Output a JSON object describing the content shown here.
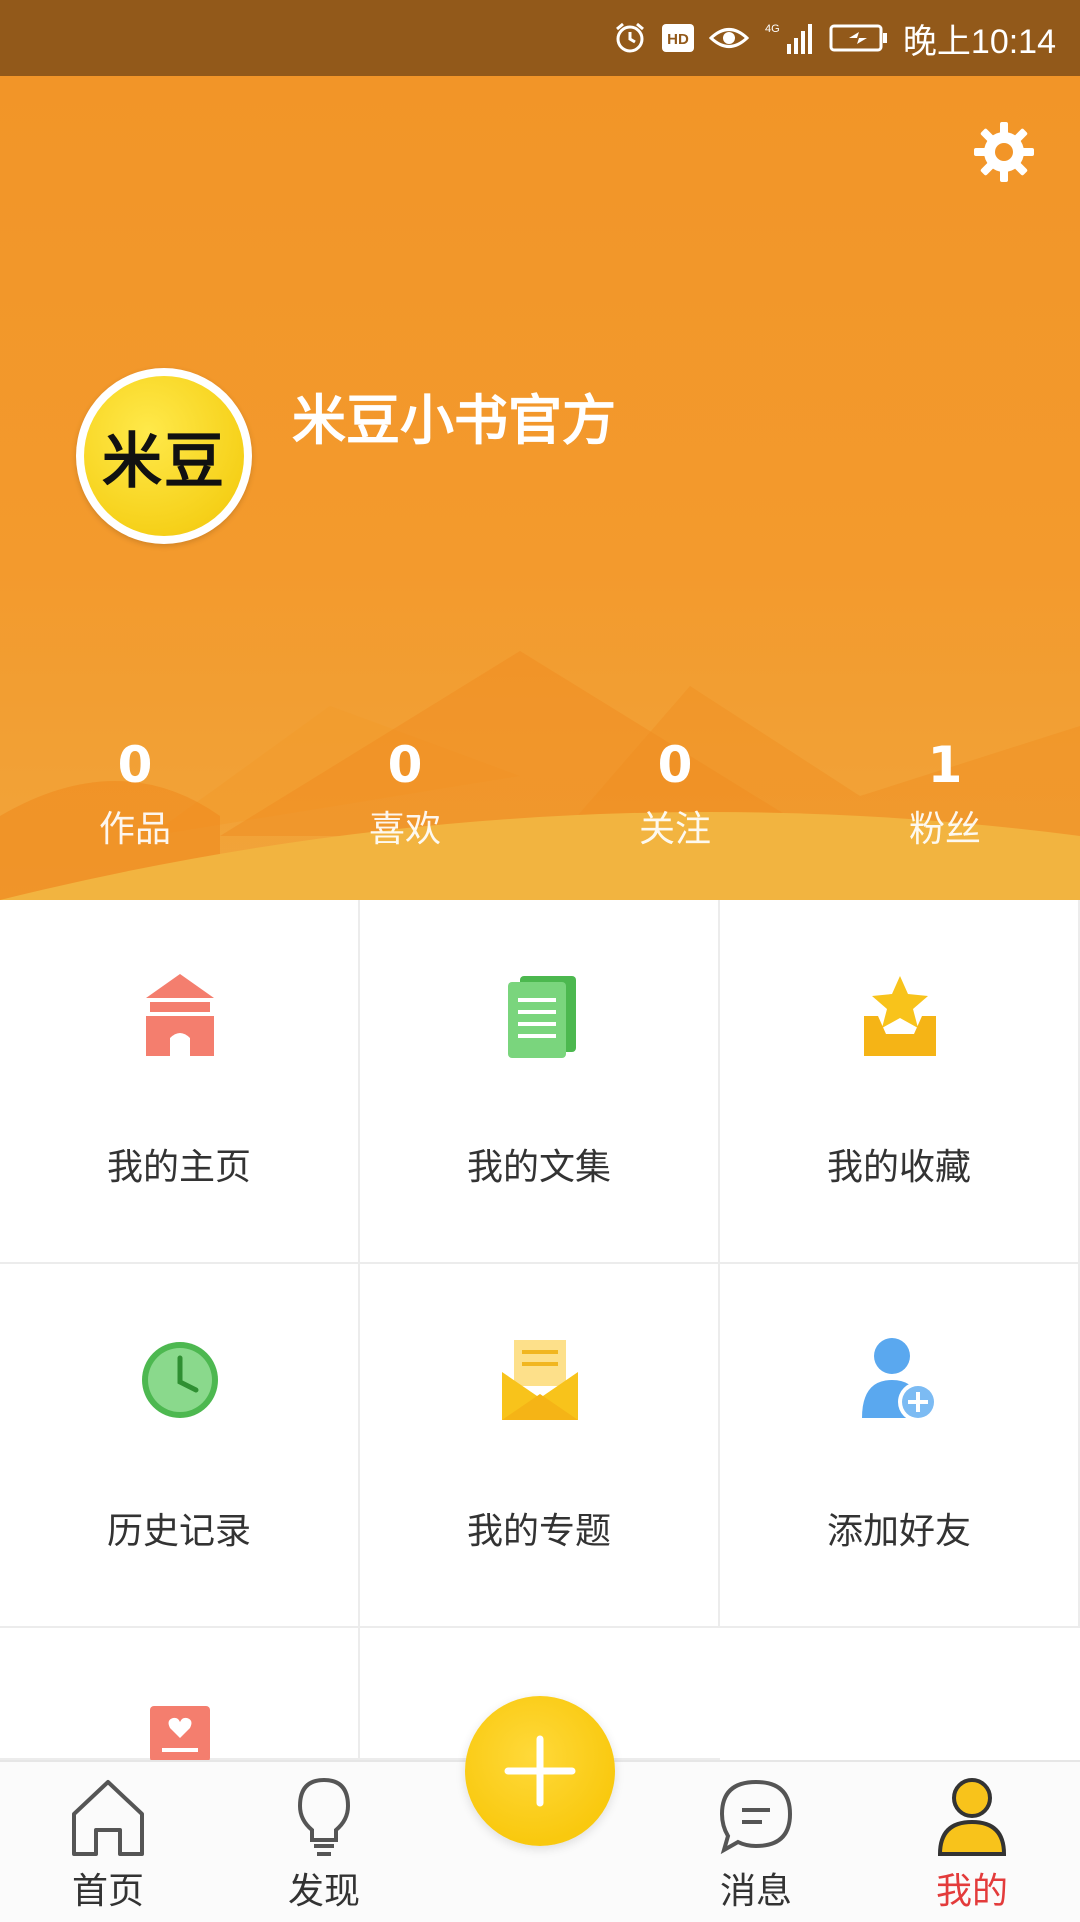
{
  "status_bar": {
    "time": "晚上10:14",
    "icons": [
      "alarm-icon",
      "hd-icon",
      "eye-icon",
      "signal-4g-icon",
      "battery-icon"
    ]
  },
  "profile": {
    "avatar_text": "米豆",
    "username": "米豆小书官方",
    "settings_icon": "gear-icon"
  },
  "stats": [
    {
      "value": "0",
      "label": "作品"
    },
    {
      "value": "0",
      "label": "喜欢"
    },
    {
      "value": "0",
      "label": "关注"
    },
    {
      "value": "1",
      "label": "粉丝"
    }
  ],
  "menu": [
    {
      "label": "我的主页",
      "icon": "home-building-icon",
      "color": "#f47e6e"
    },
    {
      "label": "我的文集",
      "icon": "documents-icon",
      "color": "#6fcf73"
    },
    {
      "label": "我的收藏",
      "icon": "star-tray-icon",
      "color": "#f8c31b"
    },
    {
      "label": "历史记录",
      "icon": "clock-icon",
      "color": "#5fcb60"
    },
    {
      "label": "我的专题",
      "icon": "envelope-icon",
      "color": "#f8c31b"
    },
    {
      "label": "添加好友",
      "icon": "add-user-icon",
      "color": "#5aa8ef"
    },
    {
      "label": "",
      "icon": "heart-card-icon",
      "color": "#f47e6e"
    }
  ],
  "tabbar": {
    "tabs": [
      {
        "label": "首页",
        "icon": "home-icon"
      },
      {
        "label": "发现",
        "icon": "lightbulb-icon"
      },
      {
        "label": "消息",
        "icon": "message-icon"
      },
      {
        "label": "我的",
        "icon": "user-icon",
        "active": true
      }
    ],
    "fab_icon": "plus-icon"
  },
  "colors": {
    "status_bar": "#92591a",
    "hero": "#f29528",
    "active_tab": "#e33b3b",
    "fab": "#f9c90f"
  }
}
